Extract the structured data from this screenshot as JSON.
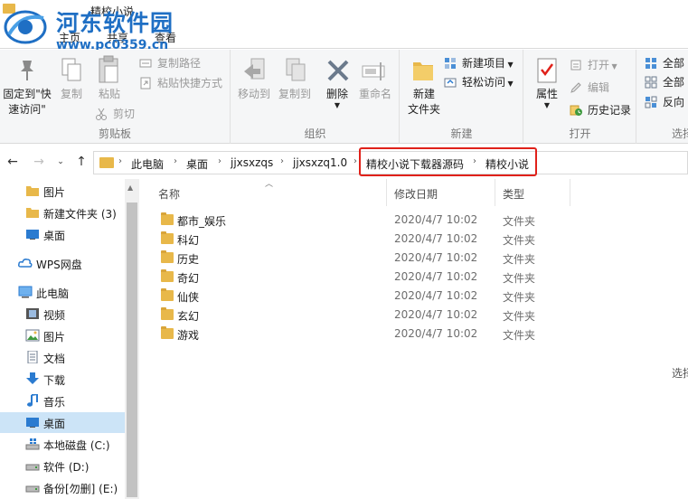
{
  "window": {
    "title": "精校小说"
  },
  "watermark": {
    "brand": "河东软件园",
    "url": "www.pc0359.cn"
  },
  "tabs": [
    {
      "label": "主页"
    },
    {
      "label": "共享"
    },
    {
      "label": "查看"
    }
  ],
  "ribbon": {
    "clipboard": {
      "label": "剪贴板",
      "pin_line1": "固定到\"快",
      "pin_line2": "速访问\"",
      "copy": "复制",
      "paste": "粘贴",
      "copy_path": "复制路径",
      "paste_shortcut": "粘贴快捷方式",
      "cut": "剪切"
    },
    "organize": {
      "label": "组织",
      "move_to": "移动到",
      "copy_to": "复制到",
      "delete": "删除",
      "rename": "重命名"
    },
    "new": {
      "label": "新建",
      "new_folder_line1": "新建",
      "new_folder_line2": "文件夹",
      "new_item": "新建项目",
      "easy_access": "轻松访问"
    },
    "open": {
      "label": "打开",
      "properties": "属性",
      "open": "打开",
      "edit": "编辑",
      "history": "历史记录"
    },
    "select": {
      "label": "选择",
      "select_all": "全部",
      "select_none": "全部",
      "invert": "反向"
    }
  },
  "address": {
    "crumbs": [
      "此电脑",
      "桌面",
      "jjxsxzqs",
      "jjxsxzq1.0",
      "精校小说下载器源码",
      "精校小说"
    ]
  },
  "sidebar": {
    "items": [
      {
        "label": "图片",
        "icon": "folder-icon"
      },
      {
        "label": "新建文件夹 (3)",
        "icon": "folder-icon"
      },
      {
        "label": "桌面",
        "icon": "desktop-icon"
      },
      {
        "label": "WPS网盘",
        "icon": "cloud-icon"
      },
      {
        "label": "此电脑",
        "icon": "computer-icon"
      },
      {
        "label": "视频",
        "icon": "video-icon"
      },
      {
        "label": "图片",
        "icon": "picture-icon"
      },
      {
        "label": "文档",
        "icon": "document-icon"
      },
      {
        "label": "下载",
        "icon": "download-icon"
      },
      {
        "label": "音乐",
        "icon": "music-icon"
      },
      {
        "label": "桌面",
        "icon": "desktop-icon"
      },
      {
        "label": "本地磁盘 (C:)",
        "icon": "windows-drive-icon"
      },
      {
        "label": "软件 (D:)",
        "icon": "drive-icon"
      },
      {
        "label": "备份[勿删] (E:)",
        "icon": "drive-icon"
      }
    ]
  },
  "list": {
    "columns": {
      "name": "名称",
      "modified": "修改日期",
      "type": "类型"
    },
    "rows": [
      {
        "name": "都市_娱乐",
        "modified": "2020/4/7 10:02",
        "type": "文件夹"
      },
      {
        "name": "科幻",
        "modified": "2020/4/7 10:02",
        "type": "文件夹"
      },
      {
        "name": "历史",
        "modified": "2020/4/7 10:02",
        "type": "文件夹"
      },
      {
        "name": "奇幻",
        "modified": "2020/4/7 10:02",
        "type": "文件夹"
      },
      {
        "name": "仙侠",
        "modified": "2020/4/7 10:02",
        "type": "文件夹"
      },
      {
        "name": "玄幻",
        "modified": "2020/4/7 10:02",
        "type": "文件夹"
      },
      {
        "name": "游戏",
        "modified": "2020/4/7 10:02",
        "type": "文件夹"
      }
    ],
    "right_hint": "选择"
  },
  "colors": {
    "highlight": "#e0211a",
    "folder": "#e8b84a",
    "selected": "#cce4f7",
    "brand": "#1f6fc4"
  }
}
